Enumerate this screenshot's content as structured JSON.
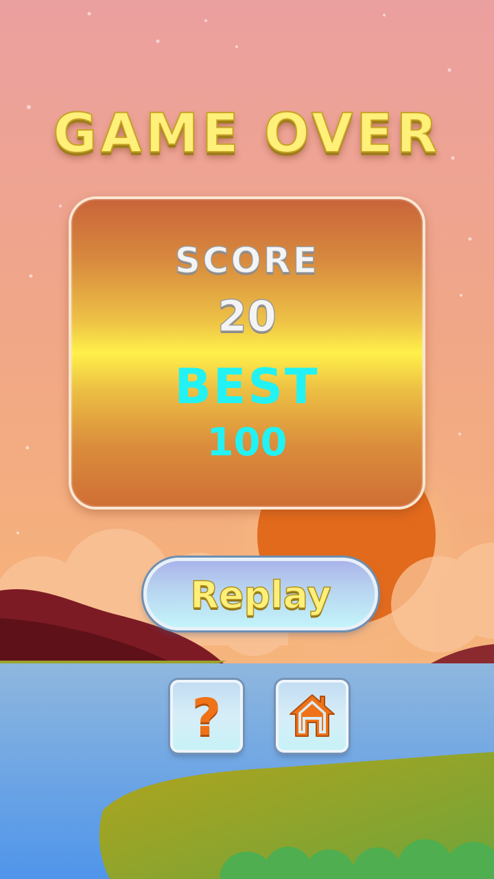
{
  "screen": {
    "title": "GAME OVER"
  },
  "scoreboard": {
    "score_label": "SCORE",
    "score_value": "20",
    "best_label": "BEST",
    "best_value": "100"
  },
  "buttons": {
    "replay_label": "Replay",
    "help_glyph": "?",
    "help_icon": "question-mark-icon",
    "home_icon": "home-icon"
  },
  "colors": {
    "title": "#fff07a",
    "best": "#22f2f4",
    "score": "#f4f4f4",
    "icon_orange": "#f07218",
    "sky_top": "#eba0a0",
    "sky_bottom": "#f6b27a",
    "sun": "#e0661a",
    "water": "#68a6e8",
    "grass": "#8aa52a"
  }
}
